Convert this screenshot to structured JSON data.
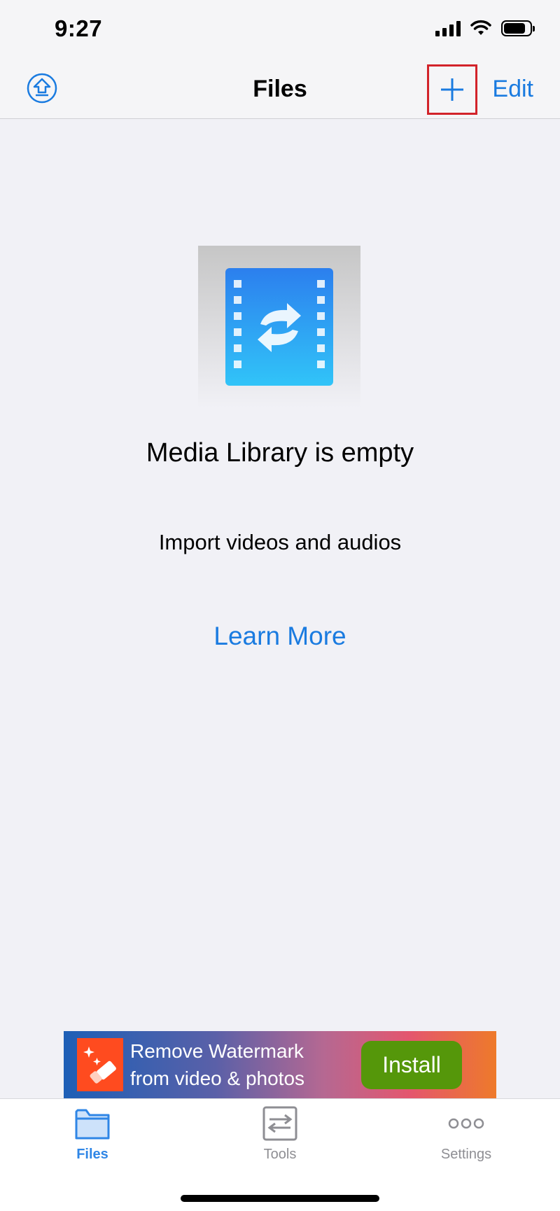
{
  "status_bar": {
    "time": "9:27",
    "icons": [
      "cellular-signal-icon",
      "wifi-icon",
      "battery-icon"
    ]
  },
  "nav": {
    "title": "Files",
    "edit_label": "Edit",
    "left_icon": "upload-icon",
    "add_icon": "plus-icon"
  },
  "empty_state": {
    "image_icon": "media-convert-icon",
    "title": "Media Library is empty",
    "subtitle": "Import videos and audios",
    "link_label": "Learn More"
  },
  "ad": {
    "line1": "Remove Watermark",
    "line2": "from video & photos",
    "button_label": "Install"
  },
  "tabs": [
    {
      "label": "Files",
      "icon": "folder-icon",
      "active": true
    },
    {
      "label": "Tools",
      "icon": "tools-icon",
      "active": false
    },
    {
      "label": "Settings",
      "icon": "more-icon",
      "active": false
    }
  ],
  "colors": {
    "accent": "#1a7be0",
    "highlight_box": "#d2232a",
    "background": "#f1f1f6",
    "ad_button": "#55970a"
  }
}
